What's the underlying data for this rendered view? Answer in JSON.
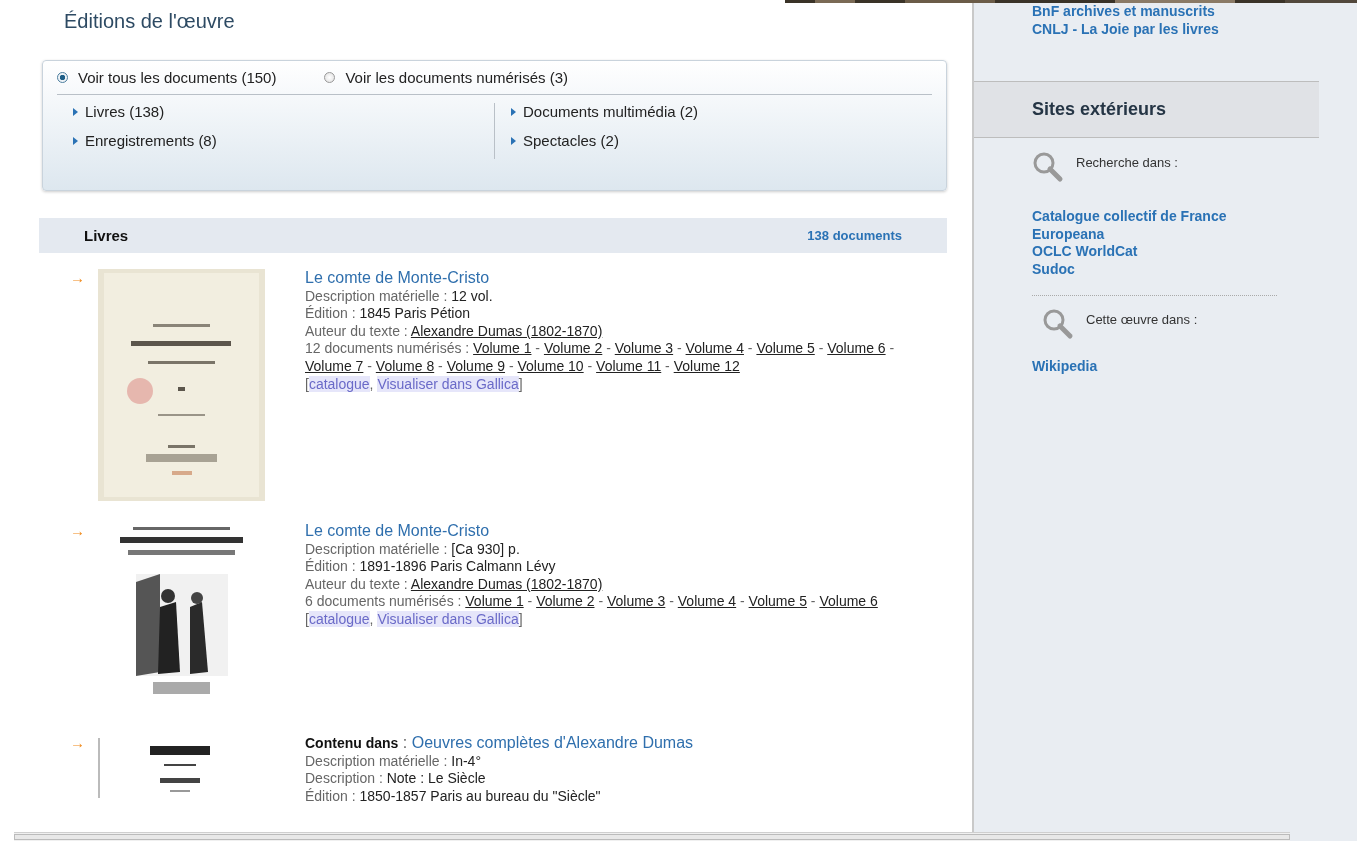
{
  "page_title": "Éditions de l'œuvre",
  "view_options": [
    {
      "label": "Voir tous les documents (150)",
      "selected": true
    },
    {
      "label": "Voir les documents numérisés (3)",
      "selected": false
    }
  ],
  "facets": [
    [
      {
        "label": "Livres (138)"
      },
      {
        "label": "Enregistrements (8)"
      }
    ],
    [
      {
        "label": "Documents multimédia (2)"
      },
      {
        "label": "Spectacles (2)"
      }
    ]
  ],
  "section": {
    "title": "Livres",
    "count": "138 documents"
  },
  "entries": [
    {
      "marker": "→",
      "title": "Le comte de Monte-Cristo",
      "fields": [
        {
          "label": "Description matérielle : ",
          "value": "12 vol."
        },
        {
          "label": "Édition : ",
          "value": "1845 Paris Pétion"
        },
        {
          "label": "Auteur du texte : ",
          "links": [
            "Alexandre Dumas (1802-1870)"
          ]
        },
        {
          "label": "12 documents numérisés : ",
          "links": [
            "Volume 1",
            "Volume 2",
            "Volume 3",
            "Volume 4",
            "Volume 5",
            "Volume 6",
            "Volume 7",
            "Volume 8",
            "Volume 9",
            "Volume 10",
            "Volume 11",
            "Volume 12"
          ],
          "separator": " - "
        }
      ],
      "actions": {
        "open": "[",
        "join": ", ",
        "close": "]",
        "items": [
          "catalogue",
          "Visualiser dans Gallica"
        ]
      },
      "cover": {
        "kind": "picture"
      }
    },
    {
      "marker": "→",
      "title": "Le comte de Monte-Cristo",
      "fields": [
        {
          "label": "Description matérielle : ",
          "value": "[Ca 930] p."
        },
        {
          "label": "Édition : ",
          "value": "1891-1896 Paris Calmann Lévy"
        },
        {
          "label": "Auteur du texte : ",
          "links": [
            "Alexandre Dumas (1802-1870)"
          ]
        },
        {
          "label": "6 documents numérisés : ",
          "links": [
            "Volume 1",
            "Volume 2",
            "Volume 3",
            "Volume 4",
            "Volume 5",
            "Volume 6"
          ],
          "separator": " - "
        }
      ],
      "actions": {
        "open": "[",
        "join": ", ",
        "close": "]",
        "items": [
          "catalogue",
          "Visualiser dans Gallica"
        ]
      },
      "cover": {
        "kind": "picture"
      }
    },
    {
      "marker": "→",
      "context": "Contenu dans",
      "context_separator": " : ",
      "title": "Oeuvres complètes d'Alexandre Dumas",
      "fields": [
        {
          "label": "Description matérielle : ",
          "value": "In-4°"
        },
        {
          "label": "Description : ",
          "value": "Note : Le Siècle"
        },
        {
          "label": "Édition : ",
          "value": "1850-1857 Paris au bureau du \"Siècle\""
        }
      ],
      "cover": {
        "kind": "picture"
      }
    }
  ],
  "sidebar": {
    "top_links": [
      "BnF archives et manuscrits",
      "CNLJ - La Joie par les livres"
    ],
    "heading": "Sites extérieurs",
    "groups": [
      {
        "caption": "Recherche dans :",
        "links": [
          "Catalogue collectif de France",
          "Europeana",
          "OCLC WorldCat",
          "Sudoc"
        ]
      },
      {
        "caption": "Cette œuvre dans :",
        "links": [
          "Wikipedia"
        ]
      }
    ]
  }
}
